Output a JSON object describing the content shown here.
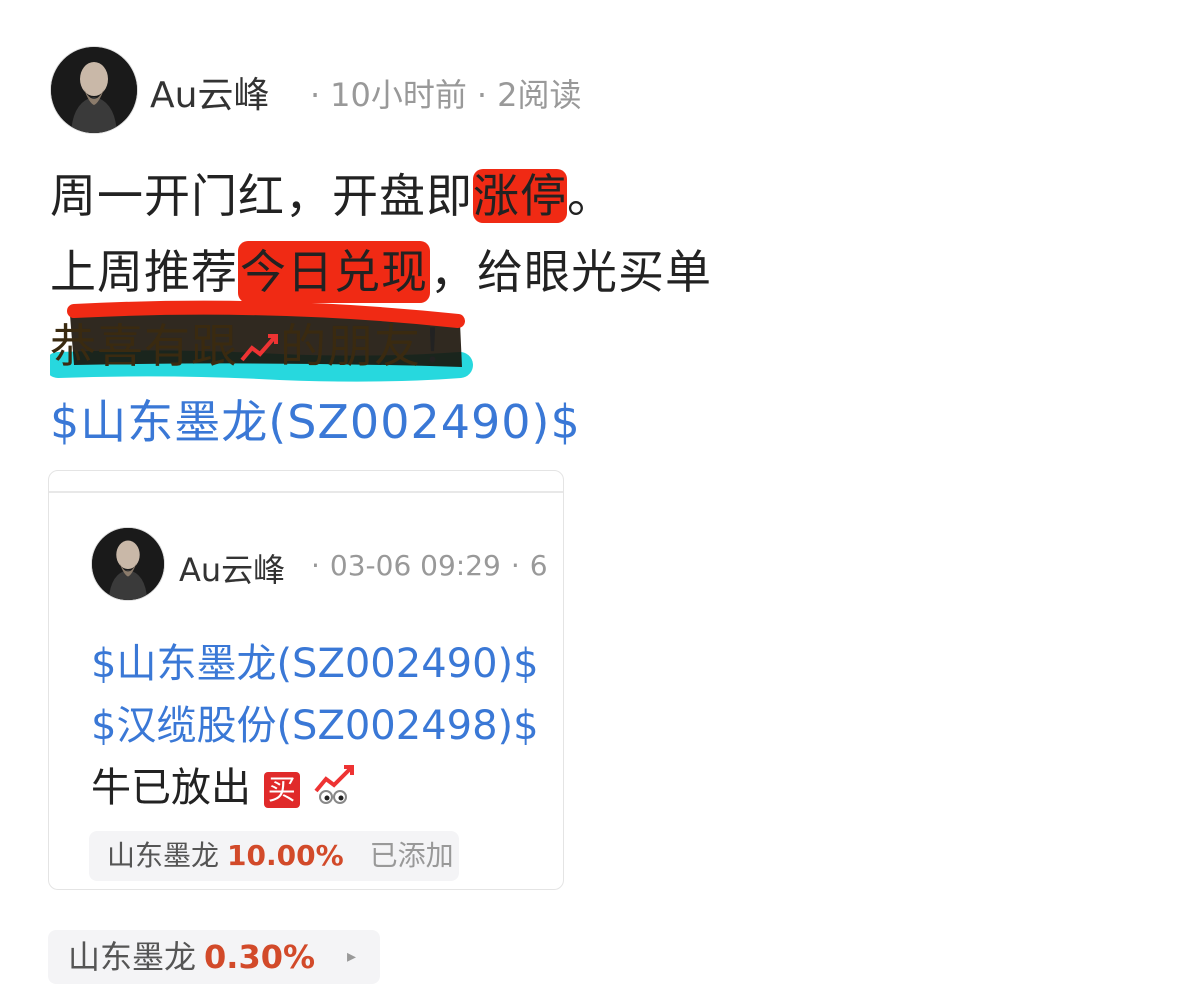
{
  "post": {
    "author": "Au云峰",
    "time": "10小时前",
    "reads": "2阅读",
    "line1_a": "周一开门红，开盘即",
    "line1_hl": "涨停",
    "line1_b": "。",
    "line2_a": "上周推荐",
    "line2_hl": "今日兑现",
    "line2_b": "，给眼光买单",
    "line3_a": "恭喜有跟",
    "line3_b": "的朋友",
    "line3_c": "！",
    "stock_tag": "$山东墨龙(SZ002490)$"
  },
  "quoted": {
    "author": "Au云峰",
    "time": "03-06 09:29",
    "more": "6",
    "tag1": "$山东墨龙(SZ002490)$",
    "tag2": "$汉缆股份(SZ002498)$",
    "text": "牛已放出",
    "buy_icon": "买",
    "chip_name": "山东墨龙",
    "chip_pct": "10.00%",
    "chip_status": "已添加"
  },
  "bottom_chip": {
    "name": "山东墨龙",
    "pct": "0.30%",
    "arrow": "▸"
  },
  "colors": {
    "link": "#3a78d6",
    "highlight_red": "#f02a14",
    "highlight_cyan": "#27d8de",
    "gain": "#d24a2a"
  },
  "icons": {
    "chart": "chart-increasing-icon",
    "eyes": "eyes-icon"
  }
}
